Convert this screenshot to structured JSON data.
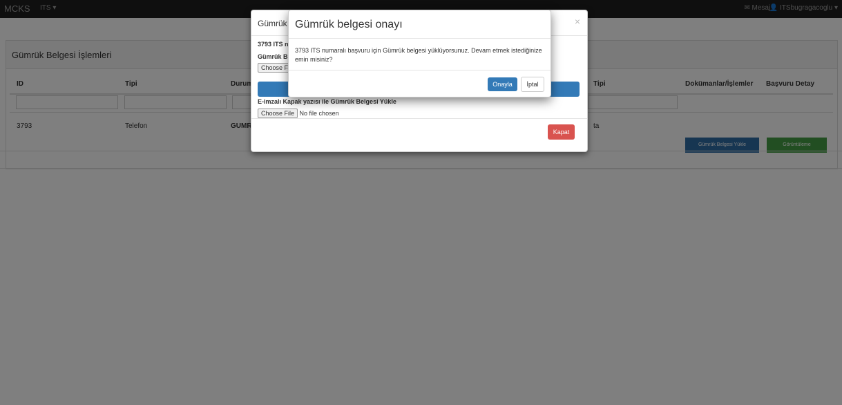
{
  "navbar": {
    "brand": "MCKS",
    "menu": "ITS ▾",
    "messages": "✉ Mesaj ▾",
    "user": "👤 ITSbugragacoglu ▾"
  },
  "panel": {
    "title": "Gümrük Belgesi İşlemleri",
    "columns": [
      "ID",
      "Tipi",
      "Durum",
      "Tipi",
      "Dokümanlar/İşlemler",
      "Başvuru Detay"
    ],
    "row": {
      "id": "3793",
      "tipi": "Telefon",
      "durum": "GUMR",
      "tipi2": "ta",
      "docs_button": "Gümrük Belgesi Yükle",
      "detail_button": "Görüntüleme"
    }
  },
  "modal_upload": {
    "title": "Gümrük",
    "close": "×",
    "line1": "3793 ITS n",
    "label1": "Gümrük B",
    "file1_button": "Choose F",
    "label2": "E-imzalı Kapak yazısı ile Gümrük Belgesi Yükle",
    "file2_button": "Choose File",
    "file2_status": "No file chosen",
    "close_button": "Kapat"
  },
  "modal_confirm": {
    "title": "Gümrük belgesi onayı",
    "message": "3793 ITS numaralı başvuru için Gümrük belgesi yüklüyorsunuz. Devam etmek istediğinize emin misiniz?",
    "confirm_button": "Onayla",
    "cancel_button": "İptal"
  }
}
